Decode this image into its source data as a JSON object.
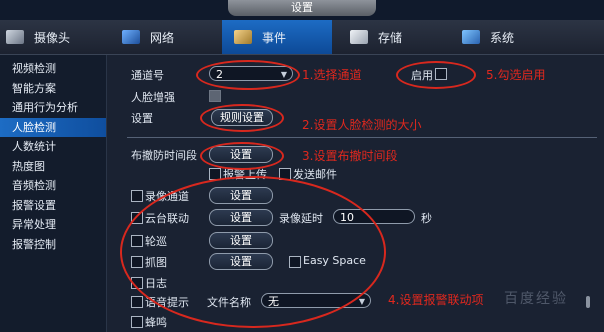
{
  "window_title": "设置",
  "tabs": [
    {
      "label": "摄像头",
      "icon": "camera-icon",
      "active": false
    },
    {
      "label": "网络",
      "icon": "network-icon",
      "active": false
    },
    {
      "label": "事件",
      "icon": "event-icon",
      "active": true
    },
    {
      "label": "存储",
      "icon": "storage-icon",
      "active": false
    },
    {
      "label": "系统",
      "icon": "system-icon",
      "active": false
    }
  ],
  "sidebar": {
    "items": [
      {
        "label": "视频检测"
      },
      {
        "label": "智能方案"
      },
      {
        "label": "通用行为分析"
      },
      {
        "label": "人脸检测",
        "active": true
      },
      {
        "label": "人数统计"
      },
      {
        "label": "热度图"
      },
      {
        "label": "音频检测"
      },
      {
        "label": "报警设置"
      },
      {
        "label": "异常处理"
      },
      {
        "label": "报警控制"
      }
    ]
  },
  "form": {
    "channel_label": "通道号",
    "channel_value": "2",
    "enable_label": "启用",
    "face_enhance_label": "人脸增强",
    "settings_label": "设置",
    "rule_settings_button": "规则设置",
    "schedule_label": "布撤防时间段",
    "schedule_button": "设置",
    "alarm_upload_label": "报警上传",
    "send_email_label": "发送邮件",
    "record_channel_label": "录像通道",
    "record_channel_button": "设置",
    "ptz_link_label": "云台联动",
    "ptz_link_button": "设置",
    "record_delay_label": "录像延时",
    "record_delay_value": "10",
    "record_delay_unit": "秒",
    "tour_label": "轮巡",
    "tour_button": "设置",
    "snapshot_label": "抓图",
    "snapshot_button": "设置",
    "easy_space_label": "Easy Space",
    "log_label": "日志",
    "voice_prompt_label": "语音提示",
    "file_name_label": "文件名称",
    "file_name_value": "无",
    "buzzer_label": "蜂鸣"
  },
  "annotations": {
    "a1": "1.选择通道",
    "a2": "2.设置人脸检测的大小",
    "a3": "3.设置布撤时间段",
    "a4": "4.设置报警联动项",
    "a5": "5.勾选启用"
  },
  "watermark": "百度经验",
  "colors": {
    "accent_blue": "#1d6cc4",
    "annotation_red": "#e0281e",
    "background": "#1a2232"
  }
}
